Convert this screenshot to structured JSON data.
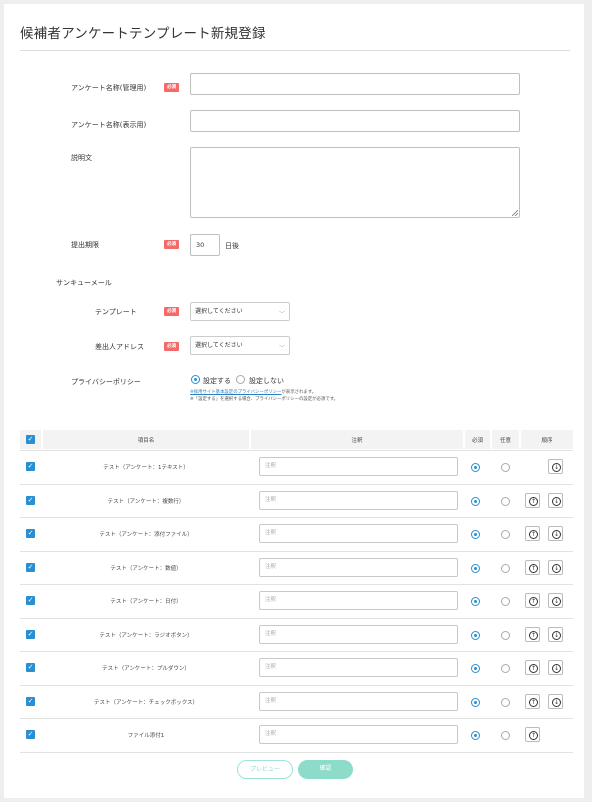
{
  "page": {
    "title": "候補者アンケートテンプレート新規登録"
  },
  "form": {
    "name_admin_label": "アンケート名称(管理用)",
    "name_display_label": "アンケート名称(表示用)",
    "description_label": "説明文",
    "deadline_label": "提出期限",
    "deadline_value": "30",
    "deadline_suffix": "日後",
    "thanks_mail_label": "サンキューメール",
    "template_label": "テンプレート",
    "template_value": "選択してください",
    "sender_label": "差出人アドレス",
    "sender_value": "選択してください",
    "privacy_label": "プライバシーポリシー",
    "privacy_on": "設定する",
    "privacy_off": "設定しない",
    "privacy_note_link": "※採用サイト基本設定のプライバシーポリシー",
    "privacy_note_rest": "が表示されます。",
    "privacy_note2": "※「設定する」を選択する場合、プライバシーポリシーの設定が必須です。",
    "required_badge": "必須"
  },
  "table": {
    "headers": {
      "name": "項目名",
      "note": "注釈",
      "required": "必須",
      "optional": "任意",
      "order": "順序"
    },
    "note_placeholder": "注釈",
    "rows": [
      {
        "name": "テスト（アンケート：1テキスト）"
      },
      {
        "name": "テスト（アンケート：複数行）"
      },
      {
        "name": "テスト（アンケート：添付ファイル）"
      },
      {
        "name": "テスト（アンケート：数値）"
      },
      {
        "name": "テスト（アンケート：日付）"
      },
      {
        "name": "テスト（アンケート：ラジオボタン）"
      },
      {
        "name": "テスト（アンケート：プルダウン）"
      },
      {
        "name": "テスト（アンケート：チェックボックス）"
      },
      {
        "name": "ファイル添付1"
      }
    ]
  },
  "buttons": {
    "preview": "プレビュー",
    "register": "確認"
  },
  "colors": {
    "accent": "#2a8fd0",
    "badge": "#f36a6a",
    "button_teal": "#7fd9c6"
  }
}
